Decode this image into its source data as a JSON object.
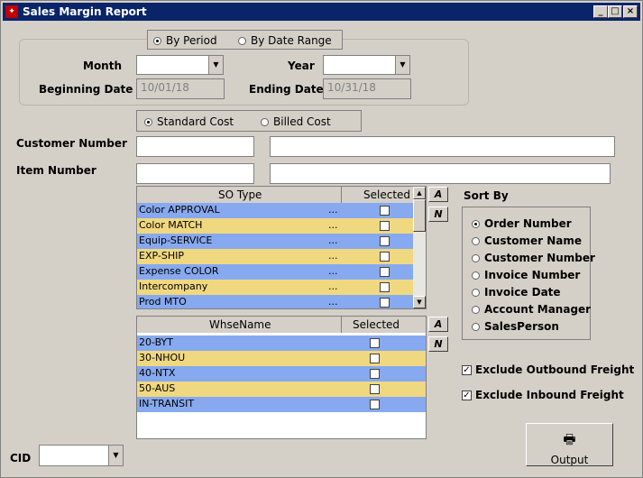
{
  "window": {
    "title": "Sales Margin Report"
  },
  "period": {
    "by_period": "By Period",
    "by_date_range": "By Date Range"
  },
  "labels": {
    "month": "Month",
    "year": "Year",
    "beginning_date": "Beginning Date",
    "ending_date": "Ending Date",
    "customer_number": "Customer Number",
    "item_number": "Item Number",
    "cid": "CID",
    "sort_by": "Sort By"
  },
  "dates": {
    "beginning": "10/01/18",
    "ending": "10/31/18"
  },
  "cost": {
    "standard": "Standard Cost",
    "billed": "Billed Cost"
  },
  "so_grid": {
    "col_type": "SO Type",
    "col_selected": "Selected",
    "rows": [
      {
        "name": "Color APPROVAL",
        "ell": "..."
      },
      {
        "name": "Color MATCH",
        "ell": "..."
      },
      {
        "name": "Equip-SERVICE",
        "ell": "..."
      },
      {
        "name": "EXP-SHIP",
        "ell": "..."
      },
      {
        "name": "Expense COLOR",
        "ell": "..."
      },
      {
        "name": "Intercompany",
        "ell": "..."
      },
      {
        "name": "Prod MTO",
        "ell": "..."
      }
    ]
  },
  "whse_grid": {
    "col_name": "WhseName",
    "col_selected": "Selected",
    "rows": [
      "20-BYT",
      "30-NHOU",
      "40-NTX",
      "50-AUS",
      "IN-TRANSIT"
    ]
  },
  "az": {
    "a": "A",
    "n": "N"
  },
  "sort_by": [
    "Order Number",
    "Customer Name",
    "Customer Number",
    "Invoice Number",
    "Invoice Date",
    "Account Manager",
    "SalesPerson"
  ],
  "freight": {
    "outbound": "Exclude Outbound Freight",
    "inbound": "Exclude Inbound Freight"
  },
  "output": {
    "label": "Output"
  },
  "colors": {
    "title_bar": "#0a246a",
    "row_blue": "#87a9f0",
    "row_yellow": "#f0d880"
  }
}
